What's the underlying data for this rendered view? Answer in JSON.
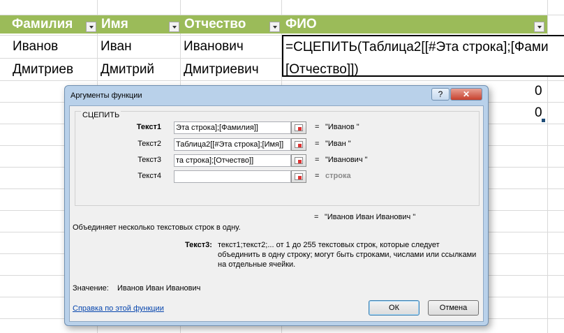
{
  "sheet": {
    "headers": [
      "Фамилия",
      "Имя",
      "Отчество",
      "ФИО"
    ],
    "rows": [
      [
        "Иванов",
        "Иван",
        "Иванович"
      ],
      [
        "Дмитриев",
        "Дмитрий",
        "Дмитриевич"
      ]
    ],
    "formula_line1": "=СЦЕПИТЬ(Таблица2[[#Эта строка];[Фами",
    "formula_line2": "[Отчество]])",
    "values": [
      "0",
      "0"
    ],
    "header_color": "#9bbb59"
  },
  "dialog": {
    "title": "Аргументы функции",
    "help_label": "?",
    "close_label": "✕",
    "function_name": "СЦЕПИТЬ",
    "args": [
      {
        "label": "Текст1",
        "value": "Эта строка];[Фамилия]]",
        "result": "\"Иванов \""
      },
      {
        "label": "Текст2",
        "value": "Таблица2[[#Эта строка];[Имя]]",
        "result": "\"Иван \""
      },
      {
        "label": "Текст3",
        "value": "та строка];[Отчество]]",
        "result": "\"Иванович \""
      },
      {
        "label": "Текст4",
        "value": "",
        "result": "строка"
      }
    ],
    "eq": "=",
    "total_result": "\"Иванов Иван Иванович \"",
    "description": "Объединяет несколько текстовых строк в одну.",
    "arg_help_label": "Текст3:",
    "arg_help_lines": [
      "текст1;текст2;... от 1 до 255 текстовых строк, которые следует",
      "объединить в одну строку; могут быть строками, числами или ссылками",
      "на отдельные ячейки."
    ],
    "value_label": "Значение:",
    "value_text": "Иванов Иван Иванович",
    "help_link": "Справка по этой функции",
    "ok_label": "ОК",
    "cancel_label": "Отмена"
  }
}
